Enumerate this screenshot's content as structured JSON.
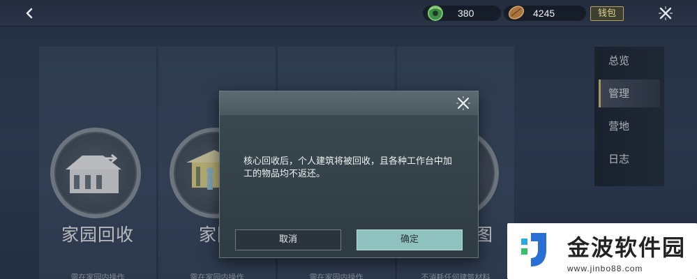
{
  "topbar": {
    "jade_amount": "380",
    "seed_amount": "4245",
    "wallet_label": "钱包"
  },
  "cards": [
    {
      "title": "家园回收",
      "subtitle": "需在家园内操作"
    },
    {
      "title": "家园",
      "subtitle": "需在家园内操作"
    },
    {
      "title": "",
      "subtitle": "需在家园内操作"
    },
    {
      "title": "图",
      "subtitle": "不消耗任何建筑材料"
    }
  ],
  "tabs": [
    {
      "label": "总览"
    },
    {
      "label": "管理"
    },
    {
      "label": "营地"
    },
    {
      "label": "日志"
    }
  ],
  "dialog": {
    "message": "核心回收后，个人建筑将被回收，且各种工作台中加工的物品均不返还。",
    "cancel_label": "取消",
    "confirm_label": "确定"
  },
  "watermark": {
    "name": "金波软件园",
    "url": "www.jinbo88.com"
  },
  "colors": {
    "accent_gold": "#d8c27a",
    "confirm_button": "#8fc1be",
    "background": "#34435c"
  }
}
